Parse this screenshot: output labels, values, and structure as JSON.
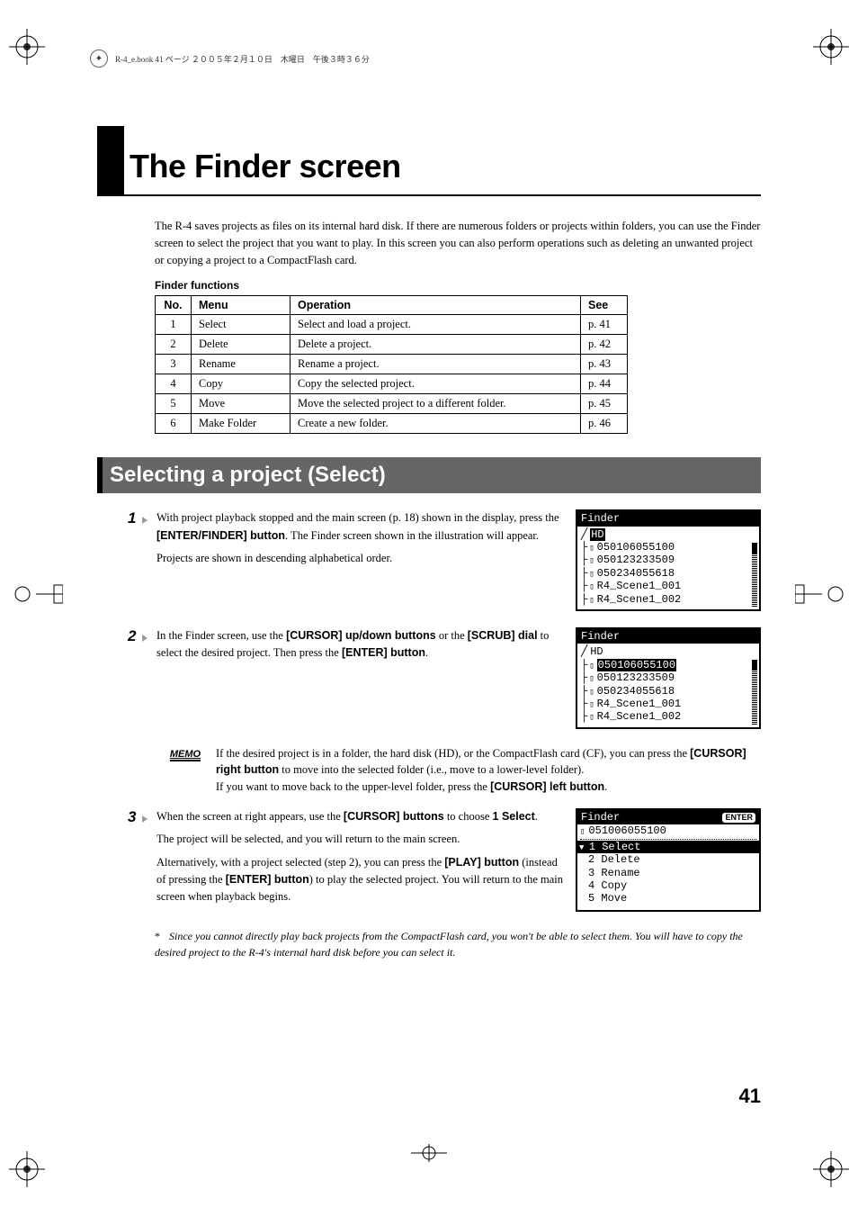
{
  "header": {
    "file_info": "R-4_e.book 41 ページ ２００５年２月１０日　木曜日　午後３時３６分"
  },
  "title": "The Finder screen",
  "intro": "The R-4 saves projects as files on its internal hard disk. If there are numerous folders or projects within folders, you can use the Finder screen to select the project that you want to play. In this screen you can also perform operations such as deleting an unwanted project or copying a project to a CompactFlash card.",
  "table": {
    "title": "Finder functions",
    "headers": {
      "no": "No.",
      "menu": "Menu",
      "operation": "Operation",
      "see": "See"
    },
    "rows": [
      {
        "no": "1",
        "menu": "Select",
        "operation": "Select and load a project.",
        "see": "p. 41"
      },
      {
        "no": "2",
        "menu": "Delete",
        "operation": "Delete a project.",
        "see": "p. 42"
      },
      {
        "no": "3",
        "menu": "Rename",
        "operation": "Rename a project.",
        "see": "p. 43"
      },
      {
        "no": "4",
        "menu": "Copy",
        "operation": "Copy the selected project.",
        "see": "p. 44"
      },
      {
        "no": "5",
        "menu": "Move",
        "operation": "Move the selected project to a different folder.",
        "see": "p. 45"
      },
      {
        "no": "6",
        "menu": "Make Folder",
        "operation": "Create a new folder.",
        "see": "p. 46"
      }
    ]
  },
  "section_header": "Selecting a project (Select)",
  "steps": {
    "s1": {
      "num": "1",
      "p1a": "With project playback stopped and the main screen (p. 18) shown in the display, press the ",
      "p1b": "[ENTER/FINDER] button",
      "p1c": ". The Finder screen shown in the illustration will appear.",
      "p2": "Projects are shown in descending alphabetical order."
    },
    "s2": {
      "num": "2",
      "p1a": "In the Finder screen, use the ",
      "p1b": "[CURSOR] up/down buttons",
      "p1c": " or the ",
      "p1d": "[SCRUB] dial",
      "p1e": " to select the desired project. Then press the ",
      "p1f": "[ENTER] button",
      "p1g": "."
    },
    "memo": {
      "label": "MEMO",
      "p1a": "If the desired project is in a folder, the hard disk (HD), or the CompactFlash card (CF), you can press the ",
      "p1b": "[CURSOR] right button",
      "p1c": " to move into the selected folder (i.e., move to a lower-level folder).",
      "p2a": "If you want to move back to the upper-level folder, press the ",
      "p2b": "[CURSOR] left button",
      "p2c": "."
    },
    "s3": {
      "num": "3",
      "p1a": "When the screen at right appears, use the ",
      "p1b": "[CURSOR] buttons",
      "p1c": " to choose ",
      "p1d": "1 Select",
      "p1e": ".",
      "p2": "The project will be selected, and you will return to the main screen.",
      "p3a": "Alternatively, with a project selected (step 2), you can press the ",
      "p3b": "[PLAY] button",
      "p3c": " (instead of pressing the ",
      "p3d": "[ENTER] button",
      "p3e": ") to play the selected project. You will return to the main screen when playback begins."
    }
  },
  "footnote": {
    "marker": "*",
    "text": "Since you cannot directly play back projects from the CompactFlash card, you won't be able to select them. You will have to copy the desired project to the R-4's internal hard disk before you can select it."
  },
  "screens": {
    "finder_title": "Finder",
    "hd_label": "HD",
    "items": [
      "050106055100",
      "050123233509",
      "050234055618",
      "R4_Scene1_001",
      "R4_Scene1_002"
    ],
    "menu": {
      "title": "Finder",
      "enter": "ENTER",
      "project": "051006055100",
      "items": [
        "1 Select",
        "2 Delete",
        "3 Rename",
        "4 Copy",
        "5 Move"
      ]
    }
  },
  "page_number": "41"
}
